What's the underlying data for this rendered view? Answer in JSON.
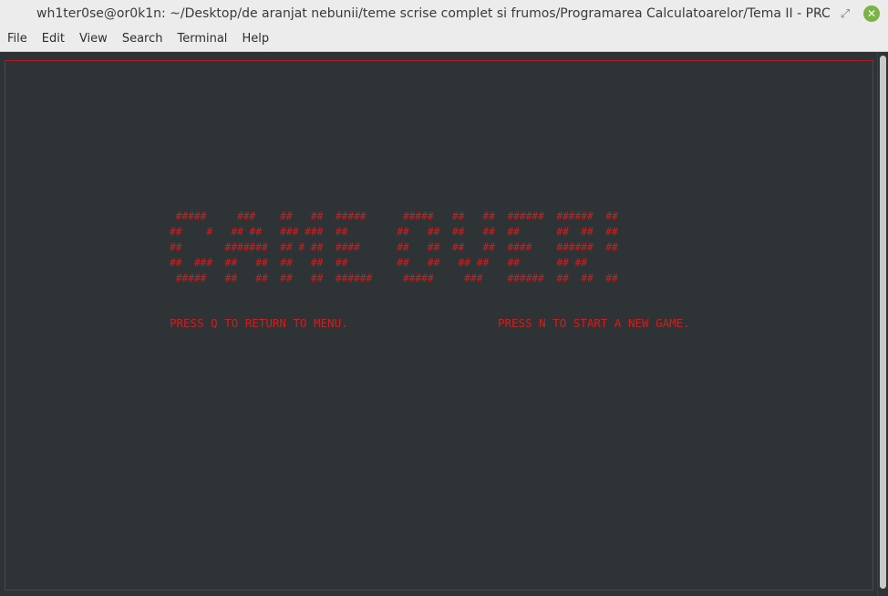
{
  "window": {
    "title": "wh1ter0se@or0k1n: ~/Desktop/de aranjat nebunii/teme scrise complet si frumos/Programarea Calculatoarelor/Tema II  - PRC",
    "controls": {
      "minimize": "–",
      "maximize": "⤢",
      "close": "✕"
    }
  },
  "menubar": {
    "items": [
      "File",
      "Edit",
      "View",
      "Search",
      "Terminal",
      "Help"
    ]
  },
  "terminal": {
    "ascii_art": [
      " #####     ###    ##   ##  #####      #####   ##   ##  ######  ######  ##",
      "##    #   ## ##   ### ###  ##        ##   ##  ##   ##  ##      ##  ##  ##",
      "##       #######  ## # ##  ####      ##   ##  ##   ##  ####    ######  ##",
      "##  ###  ##   ##  ##   ##  ##        ##   ##   ## ##   ##      ## ##",
      " #####   ##   ##  ##   ##  ######     #####     ###    ######  ##  ##  ##"
    ],
    "prompt_quit": "PRESS Q TO RETURN TO MENU.",
    "prompt_new": "PRESS N TO START A NEW GAME.",
    "colors": {
      "text": "#cc1f1f",
      "background": "#2e3436",
      "frame": "#b31c1c"
    }
  }
}
